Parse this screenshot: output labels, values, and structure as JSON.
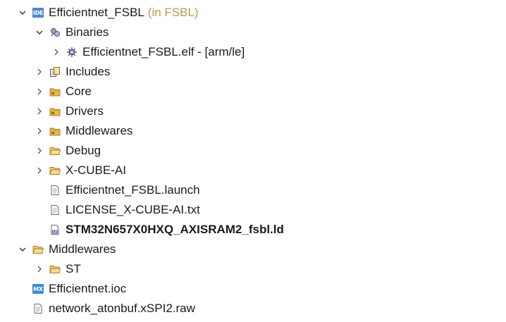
{
  "tree": {
    "root": {
      "label": "Efficientnet_FSBL",
      "qualifier": "(in FSBL)",
      "badge": "IDE"
    },
    "binaries": {
      "label": "Binaries"
    },
    "elf": {
      "label": "Efficientnet_FSBL.elf - [arm/le]"
    },
    "includes": {
      "label": "Includes"
    },
    "core": {
      "label": "Core"
    },
    "drivers": {
      "label": "Drivers"
    },
    "middlewares_src": {
      "label": "Middlewares"
    },
    "debug": {
      "label": "Debug"
    },
    "xcubeai": {
      "label": "X-CUBE-AI"
    },
    "launch": {
      "label": "Efficientnet_FSBL.launch"
    },
    "license": {
      "label": "LICENSE_X-CUBE-AI.txt"
    },
    "ld": {
      "label": "STM32N657X0HXQ_AXISRAM2_fsbl.ld",
      "badge": "LD"
    },
    "middlewares": {
      "label": "Middlewares"
    },
    "st": {
      "label": "ST"
    },
    "ioc": {
      "label": "Efficientnet.ioc",
      "badge": "MX"
    },
    "raw": {
      "label": "network_atonbuf.xSPI2.raw"
    }
  },
  "colors": {
    "ide_badge": "#4a86d4",
    "mx_badge": "#3d8bd4",
    "folder": "#e8b84a",
    "qualifier": "#b39b4a"
  }
}
